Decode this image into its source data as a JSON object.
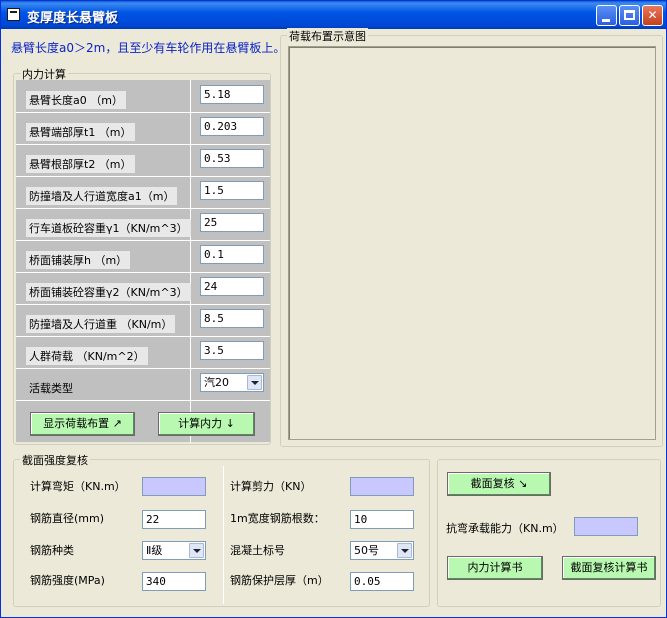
{
  "window": {
    "title": "变厚度长悬臂板"
  },
  "note": "悬臂长度a0＞2m，且至少有车轮作用在悬臂板上。",
  "internal_force": {
    "legend": "内力计算",
    "rows": [
      {
        "label": "悬臂长度a0  （m）",
        "value": "5.18"
      },
      {
        "label": "悬臂端部厚t1 （m）",
        "value": "0.203"
      },
      {
        "label": "悬臂根部厚t2 （m）",
        "value": "0.53"
      },
      {
        "label": "防撞墙及人行道宽度a1（m）",
        "value": "1.5"
      },
      {
        "label": "行车道板砼容重γ1（KN/m^3）",
        "value": "25"
      },
      {
        "label": "桥面铺装厚h （m）",
        "value": "0.1"
      },
      {
        "label": "桥面铺装砼容重γ2（KN/m^3）",
        "value": "24"
      },
      {
        "label": "防撞墙及人行道重 （KN/m）",
        "value": "8.5"
      },
      {
        "label": "人群荷载 （KN/m^2）",
        "value": "3.5"
      }
    ],
    "live_load_label": "活载类型",
    "live_load_value": "汽20",
    "show_load_button": "显示荷载布置 ↗",
    "calc_force_button": "计算内力 ↓"
  },
  "load_diagram": {
    "legend": "荷载布置示意图"
  },
  "section_check": {
    "legend": "截面强度复核",
    "moment_label": "计算弯矩（KN.m）",
    "moment_value": "",
    "shear_label": "计算剪力（KN）",
    "shear_value": "",
    "bar_diameter_label": "钢筋直径(mm)",
    "bar_diameter_value": "22",
    "bar_count_label": "1m宽度钢筋根数：",
    "bar_count_value": "10",
    "bar_type_label": "钢筋种类",
    "bar_type_value": "Ⅱ级",
    "concrete_label": "混凝土标号",
    "concrete_value": "50号",
    "bar_strength_label": "钢筋强度(MPa)",
    "bar_strength_value": "340",
    "cover_label": "钢筋保护层厚（m）",
    "cover_value": "0.05"
  },
  "check_panel": {
    "check_button": "截面复核 ↘",
    "capacity_label": "抗弯承载能力（KN.m）",
    "capacity_value": "",
    "force_report_button": "内力计算书",
    "check_report_button": "截面复核计算书"
  },
  "colors": {
    "title_bar": "#0055e5",
    "window_bg": "#ece9d8",
    "note_text": "#0a24c8",
    "green_button": "#b8f8b0",
    "output_field": "#c8c8ff"
  }
}
